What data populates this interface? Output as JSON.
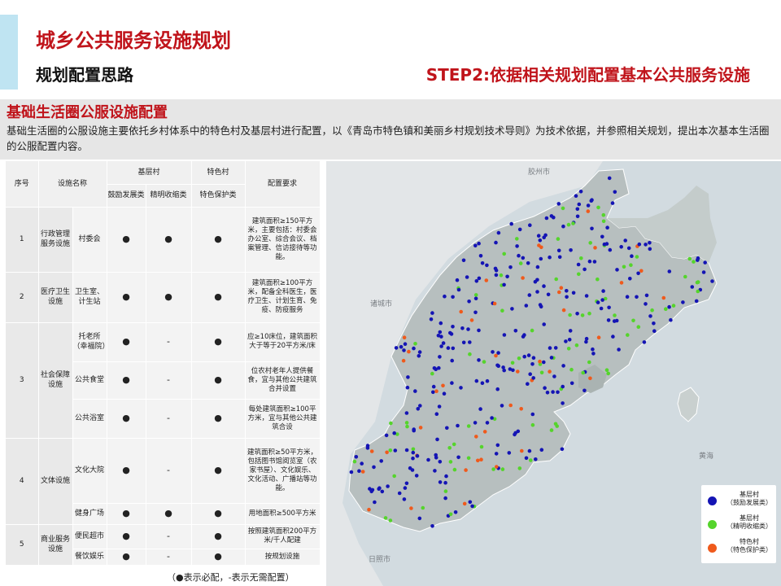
{
  "header": {
    "title": "城乡公共服务设施规划",
    "subtitle": "规划配置思路",
    "step": "STEP2:依据相关规划配置基本公共服务设施"
  },
  "intro": {
    "title": "基础生活圈公服设施配置",
    "text": "基础生活圈的公服设施主要依托乡村体系中的特色村及基层村进行配置，以《青岛市特色镇和美丽乡村规划技术导则》为技术依据，并参照相关规划，提出本次基本生活圈的公服配置内容。"
  },
  "table": {
    "headers": {
      "no": "序号",
      "name": "设施名称",
      "basic_village": "基层村",
      "special_village": "特色村",
      "requirement": "配置要求",
      "encourage": "鼓励发展类",
      "refine": "精明收缩类",
      "protect": "特色保护类"
    },
    "groups": [
      {
        "no": "1",
        "category": "行政管理服务设施",
        "items": [
          {
            "name": "村委会",
            "encourage": "●",
            "refine": "●",
            "protect": "●",
            "requirement": "建筑面积≥150平方米，主要包括：村委会办公室、综合会议、档案管理、信访接待等功能。"
          }
        ]
      },
      {
        "no": "2",
        "category": "医疗卫生设施",
        "items": [
          {
            "name": "卫生室、计生站",
            "encourage": "●",
            "refine": "●",
            "protect": "●",
            "requirement": "建筑面积≥100平方米，配备全科医生，医疗卫生、计划生育、免疫、防疫服务"
          }
        ]
      },
      {
        "no": "3",
        "category": "社会保障设施",
        "items": [
          {
            "name": "托老所（幸福院）",
            "encourage": "●",
            "refine": "-",
            "protect": "●",
            "requirement": "应≥10床位，建筑面积大于等于20平方米/床"
          },
          {
            "name": "公共食堂",
            "encourage": "●",
            "refine": "-",
            "protect": "●",
            "requirement": "位农村老年人提供餐食，宜与其他公共建筑合并设置"
          },
          {
            "name": "公共浴室",
            "encourage": "●",
            "refine": "-",
            "protect": "●",
            "requirement": "每处建筑面积≥100平方米，宜与其他公共建筑合设"
          }
        ]
      },
      {
        "no": "4",
        "category": "文体设施",
        "items": [
          {
            "name": "文化大院",
            "encourage": "●",
            "refine": "-",
            "protect": "●",
            "requirement": "建筑面积≥50平方米，包括图书馆阅览室（农家书屋）、文化娱乐、文化活动、广播站等功能。"
          },
          {
            "name": "健身广场",
            "encourage": "●",
            "refine": "●",
            "protect": "●",
            "requirement": "用地面积≥500平方米"
          }
        ]
      },
      {
        "no": "5",
        "category": "商业服务设施",
        "items": [
          {
            "name": "便民超市",
            "encourage": "●",
            "refine": "-",
            "protect": "●",
            "requirement": "按照建筑面积200平方米/千人配建"
          },
          {
            "name": "餐饮娱乐",
            "encourage": "●",
            "refine": "-",
            "protect": "●",
            "requirement": "按规划设施"
          }
        ]
      }
    ],
    "footnote": "（●表示必配，-表示无需配置）"
  },
  "map": {
    "labels": [
      "胶州市",
      "诸城市",
      "日照市",
      "黄海"
    ],
    "colors": {
      "encourage": "#1414b4",
      "refine": "#55d42c",
      "protect": "#ef5a1c"
    },
    "legend": [
      {
        "label": "基层村",
        "sub": "（鼓励发展类）",
        "color": "#1414b4"
      },
      {
        "label": "基层村",
        "sub": "（精明收缩类）",
        "color": "#55d42c"
      },
      {
        "label": "特色村",
        "sub": "（特色保护类）",
        "color": "#ef5a1c"
      }
    ]
  }
}
